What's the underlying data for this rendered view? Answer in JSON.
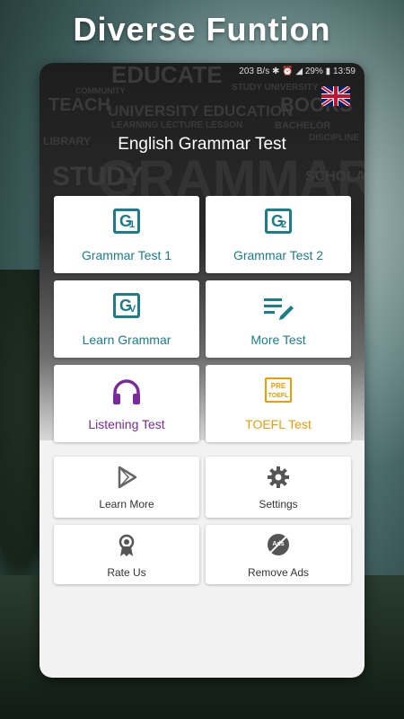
{
  "promo": {
    "title": "Diverse Funtion"
  },
  "status_bar": {
    "net_speed": "203 B/s",
    "battery": "29%",
    "time": "13:59"
  },
  "app": {
    "title": "English Grammar Test"
  },
  "word_cloud": [
    "EDUCATE",
    "COMMUNITY",
    "TEACH",
    "UNIVERSITY EDUCATION",
    "LEARNING LECTURE LESSON",
    "STUDY UNIVERSITY",
    "BOOKS",
    "GRAMMAR",
    "STUDY",
    "BACHELOR",
    "DISCIPLINE",
    "LIBRARY",
    "SCHOLAR"
  ],
  "menu": {
    "grammar_test_1": {
      "label": "Grammar Test 1",
      "icon": "g1-icon",
      "letter": "G",
      "sub": "1"
    },
    "grammar_test_2": {
      "label": "Grammar Test 2",
      "icon": "g2-icon",
      "letter": "G",
      "sub": "2"
    },
    "learn_grammar": {
      "label": "Learn Grammar",
      "icon": "learn-grammar-icon",
      "letter": "G",
      "sub": "V"
    },
    "more_test": {
      "label": "More Test",
      "icon": "edit-list-icon"
    },
    "listening_test": {
      "label": "Listening Test",
      "icon": "headphones-icon"
    },
    "toefl_test": {
      "label": "TOEFL Test",
      "icon": "pre-toefl-icon",
      "badge_top": "PRE",
      "badge_bottom": "TOEFL"
    },
    "learn_more": {
      "label": "Learn More",
      "icon": "play-store-icon"
    },
    "settings": {
      "label": "Settings",
      "icon": "gear-icon"
    },
    "rate_us": {
      "label": "Rate Us",
      "icon": "award-ribbon-icon"
    },
    "remove_ads": {
      "label": "Remove Ads",
      "icon": "remove-ads-icon",
      "glyph": "Ads"
    }
  },
  "colors": {
    "teal": "#1a7d8a",
    "purple": "#7a2a9c",
    "orange": "#f29a00"
  }
}
